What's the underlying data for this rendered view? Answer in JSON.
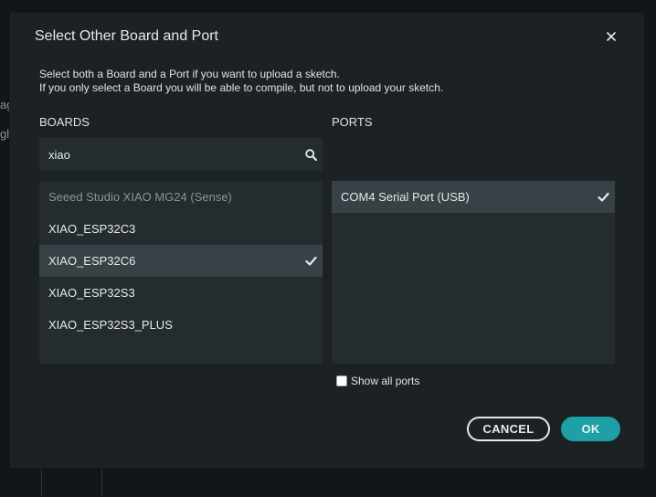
{
  "background": {
    "fragment_1": "ag",
    "fragment_2": "gl"
  },
  "dialog": {
    "title": "Select Other Board and Port",
    "description_line1": "Select both a Board and a Port if you want to upload a sketch.",
    "description_line2": "If you only select a Board you will be able to compile, but not to upload your sketch.",
    "close_icon": "close-icon"
  },
  "boards": {
    "label": "BOARDS",
    "search_value": "xiao",
    "search_icon": "search-icon",
    "items": [
      {
        "label": "Seeed Studio XIAO MG24 (Sense)",
        "disabled": true,
        "selected": false
      },
      {
        "label": "XIAO_ESP32C3",
        "disabled": false,
        "selected": false
      },
      {
        "label": "XIAO_ESP32C6",
        "disabled": false,
        "selected": true
      },
      {
        "label": "XIAO_ESP32S3",
        "disabled": false,
        "selected": false
      },
      {
        "label": "XIAO_ESP32S3_PLUS",
        "disabled": false,
        "selected": false
      }
    ]
  },
  "ports": {
    "label": "PORTS",
    "items": [
      {
        "label": "COM4 Serial Port (USB)",
        "selected": true
      }
    ],
    "show_all_label": "Show all ports",
    "show_all_checked": false
  },
  "buttons": {
    "cancel_label": "CANCEL",
    "ok_label": "OK"
  },
  "colors": {
    "dialog_bg": "#1b2125",
    "panel_bg": "#252c30",
    "selected_bg": "#384145",
    "accent": "#1da0a6"
  }
}
